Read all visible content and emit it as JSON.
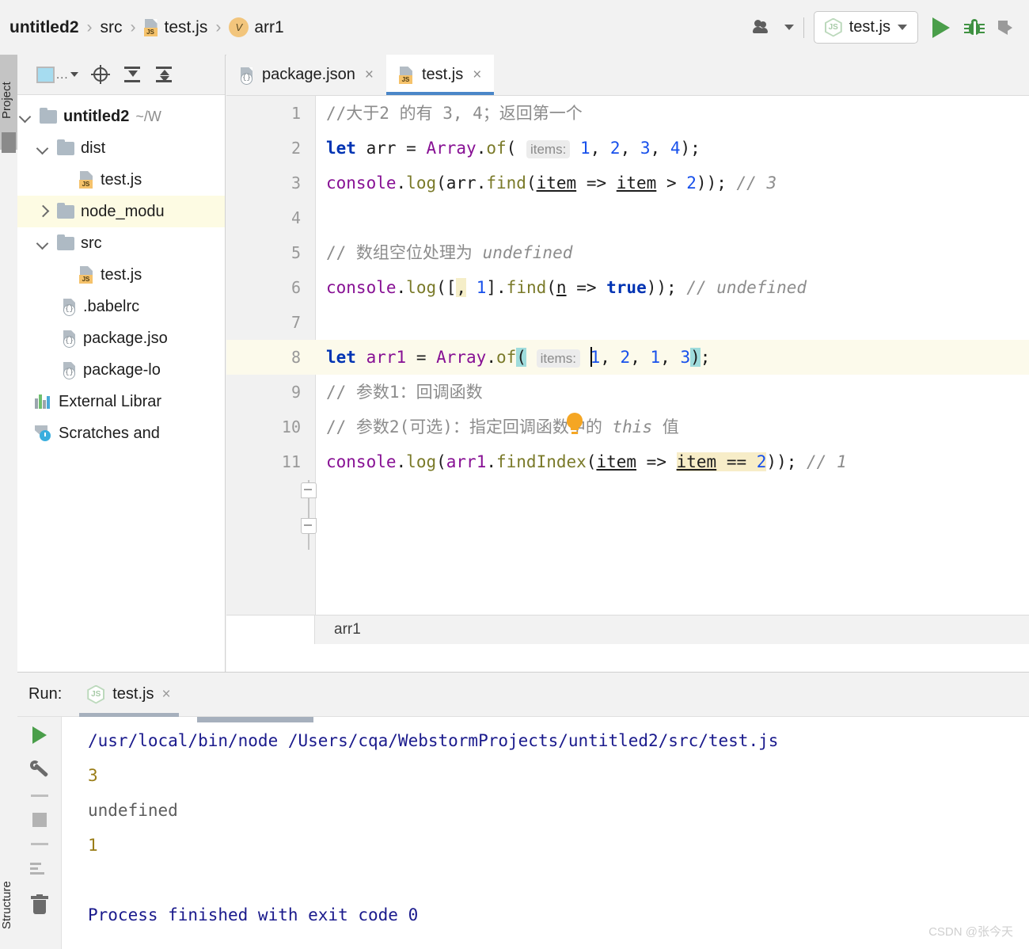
{
  "breadcrumb": {
    "items": [
      {
        "label": "untitled2",
        "icon": "none",
        "bold": true
      },
      {
        "label": "src",
        "icon": "none",
        "bold": false
      },
      {
        "label": "test.js",
        "icon": "js-file-icon",
        "bold": false
      },
      {
        "label": "arr1",
        "icon": "variable-badge-icon",
        "badge": "V",
        "bold": false
      }
    ],
    "separator": "›"
  },
  "toolbar": {
    "people_icon": "people-icon",
    "people_dropdown_icon": "chevron-down-icon",
    "run_config": {
      "label": "test.js",
      "icon": "nodejs-icon",
      "dropdown_icon": "chevron-down-icon"
    },
    "run_button": "run-icon",
    "debug_button": "debug-bug-icon",
    "coverage_button": "run-with-coverage-icon"
  },
  "tool_strips": {
    "project_tab": "Project",
    "structure_tab": "Structure"
  },
  "project_panel": {
    "toolbar": {
      "view_selector": "...",
      "locate_icon": "locate-target-icon",
      "expand_all_icon": "expand-all-icon",
      "collapse_all_icon": "collapse-all-icon"
    },
    "tree": [
      {
        "label": "untitled2",
        "suffix": "~/W",
        "icon": "folder-icon",
        "chevron": "down",
        "indent": 0,
        "bold": true,
        "highlight": false
      },
      {
        "label": "dist",
        "suffix": "",
        "icon": "folder-icon",
        "chevron": "down",
        "indent": 1,
        "bold": false,
        "highlight": false
      },
      {
        "label": "test.js",
        "suffix": "",
        "icon": "js-file-icon",
        "chevron": "none",
        "indent": 2,
        "bold": false,
        "highlight": false
      },
      {
        "label": "node_modu",
        "suffix": "",
        "icon": "folder-icon",
        "chevron": "right",
        "indent": 1,
        "bold": false,
        "highlight": true
      },
      {
        "label": "src",
        "suffix": "",
        "icon": "folder-icon",
        "chevron": "down",
        "indent": 1,
        "bold": false,
        "highlight": false
      },
      {
        "label": "test.js",
        "suffix": "",
        "icon": "js-file-icon",
        "chevron": "none",
        "indent": 2,
        "bold": false,
        "highlight": false
      },
      {
        "label": ".babelrc",
        "suffix": "",
        "icon": "json-file-icon",
        "chevron": "none",
        "indent": 2,
        "bold": false,
        "highlight": false
      },
      {
        "label": "package.jso",
        "suffix": "",
        "icon": "json-file-icon",
        "chevron": "none",
        "indent": 2,
        "bold": false,
        "highlight": false
      },
      {
        "label": "package-lo",
        "suffix": "",
        "icon": "json-file-icon",
        "chevron": "none",
        "indent": 2,
        "bold": false,
        "highlight": false
      },
      {
        "label": "External Librar",
        "suffix": "",
        "icon": "external-libraries-icon",
        "chevron": "none",
        "indent": 1,
        "bold": false,
        "highlight": false
      },
      {
        "label": "Scratches and",
        "suffix": "",
        "icon": "scratches-icon",
        "chevron": "none",
        "indent": 1,
        "bold": false,
        "highlight": false
      }
    ]
  },
  "editor": {
    "tabs": [
      {
        "label": "package.json",
        "icon": "json-file-icon",
        "active": false,
        "close_icon": "×"
      },
      {
        "label": "test.js",
        "icon": "js-file-icon",
        "active": true,
        "close_icon": "×"
      }
    ],
    "line_numbers": [
      "1",
      "2",
      "3",
      "4",
      "5",
      "6",
      "7",
      "8",
      "9",
      "10",
      "11"
    ],
    "code_lines": [
      {
        "n": "1",
        "text": "//大于2 的有 3, 4；返回第一个"
      },
      {
        "n": "2",
        "text": "let arr = Array.of( items: 1, 2, 3, 4);"
      },
      {
        "n": "3",
        "text": "console.log(arr.find(item => item > 2)); // 3"
      },
      {
        "n": "4",
        "text": ""
      },
      {
        "n": "5",
        "text": "// 数组空位处理为 undefined"
      },
      {
        "n": "6",
        "text": "console.log([, 1].find(n => true)); // undefined"
      },
      {
        "n": "7",
        "text": ""
      },
      {
        "n": "8",
        "text": "let arr1 = Array.of( items: 1, 2, 1, 3);"
      },
      {
        "n": "9",
        "text": "// 参数1：回调函数"
      },
      {
        "n": "10",
        "text": "// 参数2(可选)：指定回调函数中的 this 值"
      },
      {
        "n": "11",
        "text": "console.log(arr1.findIndex(item => item == 2)); // 1"
      }
    ],
    "parameter_hint": "items:",
    "intention_bulb_icon": "lightbulb-icon",
    "caret_line": 8,
    "breadcrumb_bottom": "arr1"
  },
  "run_panel": {
    "title": "Run:",
    "tab": {
      "label": "test.js",
      "icon": "nodejs-icon",
      "close_icon": "×"
    },
    "sidebar_icons": [
      "rerun-icon",
      "settings-wrench-icon",
      "divider",
      "stop-icon",
      "soft-wrap-icon",
      "trash-icon"
    ],
    "output": [
      {
        "text": "/usr/local/bin/node /Users/cqa/WebstormProjects/untitled2/src/test.js",
        "kind": "cmd"
      },
      {
        "text": "3",
        "kind": "num"
      },
      {
        "text": "undefined",
        "kind": "plain"
      },
      {
        "text": "1",
        "kind": "num"
      },
      {
        "text": "",
        "kind": "plain"
      },
      {
        "text": "Process finished with exit code 0",
        "kind": "done"
      }
    ]
  },
  "watermark": "CSDN @张今天",
  "colors": {
    "accent_blue": "#4a86c8",
    "run_green": "#4a9e4a",
    "keyword": "#0033b3",
    "class_name": "#871094",
    "function_name": "#7a7a29",
    "number": "#1750eb",
    "comment": "#8c8c8c",
    "caret_line_bg": "#fcfaeb",
    "warning_bg": "#f7edc8",
    "brace_match_bg": "#9fdcdc",
    "tree_highlight_bg": "#fdfbe3"
  }
}
